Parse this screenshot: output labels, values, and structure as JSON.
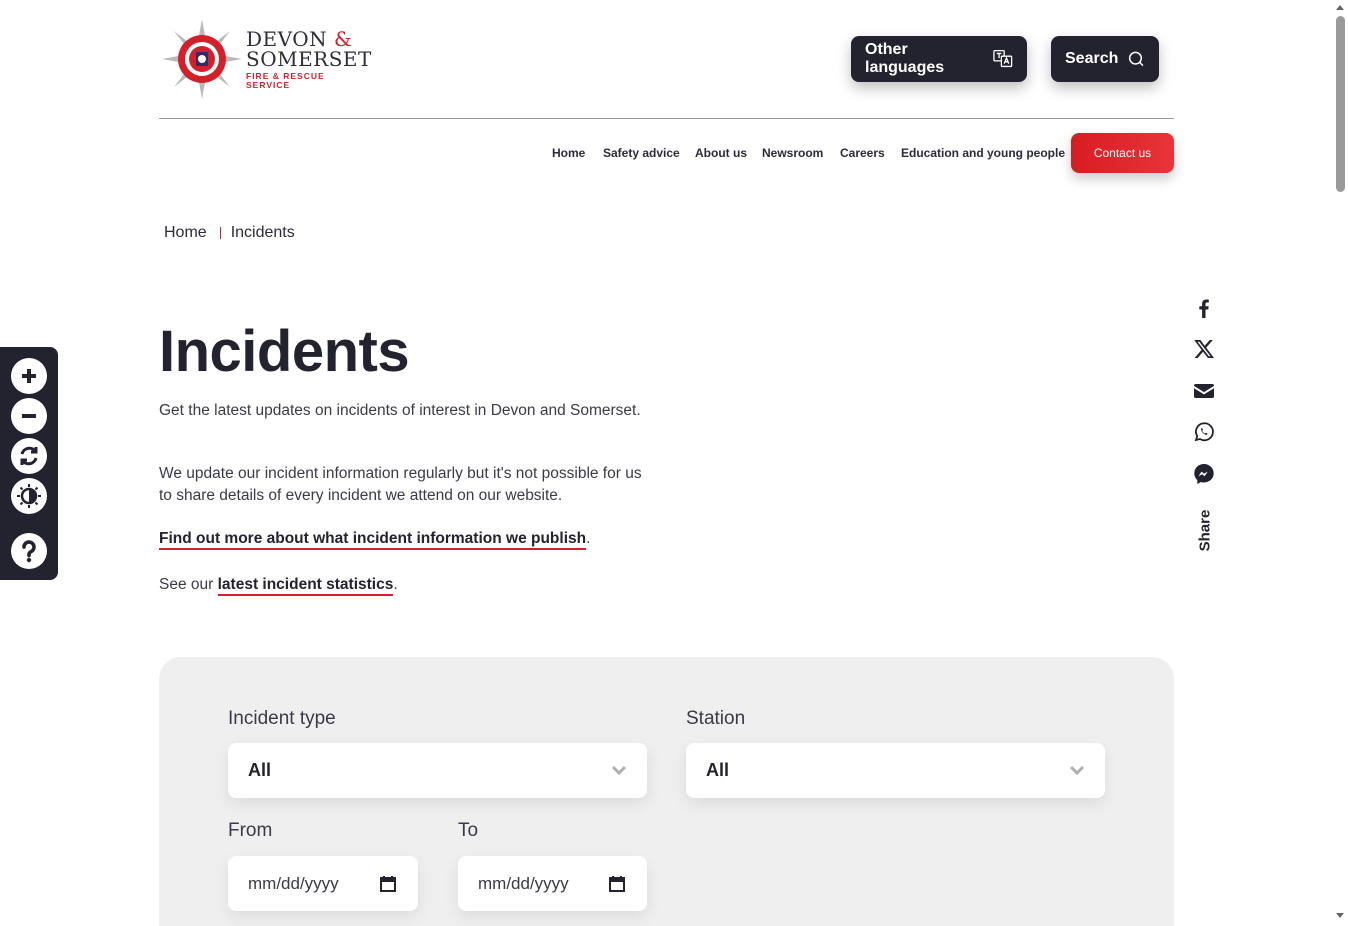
{
  "header": {
    "logo": {
      "line1": "DEVON",
      "amp": " &",
      "line2": "SOMERSET",
      "line3": "FIRE & RESCUE SERVICE"
    },
    "other_languages_label": "Other languages",
    "search_label": "Search"
  },
  "nav": {
    "items": [
      "Home",
      "Safety advice",
      "About us",
      "Newsroom",
      "Careers",
      "Education and young people"
    ],
    "contact_label": "Contact us"
  },
  "breadcrumb": {
    "home": "Home",
    "current": "Incidents"
  },
  "page": {
    "title": "Incidents",
    "intro1": "Get the latest updates on incidents of interest in Devon and Somerset.",
    "intro2": "We update our incident information regularly but it's not possible for us to share details of every incident we attend on our website.",
    "link_find_out": "Find out more about what incident information we publish",
    "link_find_out_suffix": ".",
    "stats_prefix": "See our ",
    "link_stats": "latest incident statistics",
    "stats_suffix": "."
  },
  "share": {
    "label": "Share",
    "icons": [
      "facebook-icon",
      "x-icon",
      "email-icon",
      "whatsapp-icon",
      "messenger-icon"
    ]
  },
  "accessibility_toolbar": {
    "icons": [
      "zoom-in-icon",
      "zoom-out-icon",
      "reset-icon",
      "contrast-icon",
      "help-icon"
    ]
  },
  "filters": {
    "incident_type": {
      "label": "Incident type",
      "value": "All"
    },
    "station": {
      "label": "Station",
      "value": "All"
    },
    "from": {
      "label": "From",
      "placeholder": "mm/dd/yyyy"
    },
    "to": {
      "label": "To",
      "placeholder": "mm/dd/yyyy"
    }
  },
  "colors": {
    "brand_dark": "#23232f",
    "brand_red": "#d4202a",
    "panel_bg": "#efefef"
  }
}
